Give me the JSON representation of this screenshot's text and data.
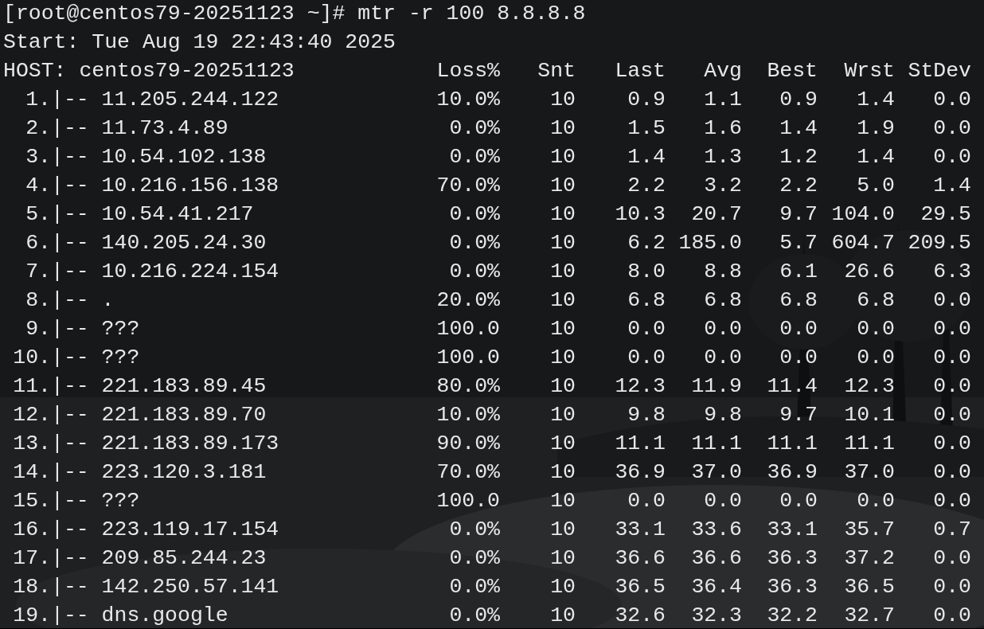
{
  "prompt": "[root@centos79-20251123 ~]# mtr -r 100 8.8.8.8",
  "start": "Start: Tue Aug 19 22:43:40 2025",
  "report": {
    "host_label": "HOST: centos79-20251123",
    "columns": [
      "Loss%",
      "Snt",
      "Last",
      "Avg",
      "Best",
      "Wrst",
      "StDev"
    ],
    "rows": [
      {
        "hop": "1.",
        "host": "|-- 11.205.244.122",
        "values": [
          "10.0%",
          "10",
          "0.9",
          "1.1",
          "0.9",
          "1.4",
          "0.0"
        ]
      },
      {
        "hop": "2.",
        "host": "|-- 11.73.4.89",
        "values": [
          "0.0%",
          "10",
          "1.5",
          "1.6",
          "1.4",
          "1.9",
          "0.0"
        ]
      },
      {
        "hop": "3.",
        "host": "|-- 10.54.102.138",
        "values": [
          "0.0%",
          "10",
          "1.4",
          "1.3",
          "1.2",
          "1.4",
          "0.0"
        ]
      },
      {
        "hop": "4.",
        "host": "|-- 10.216.156.138",
        "values": [
          "70.0%",
          "10",
          "2.2",
          "3.2",
          "2.2",
          "5.0",
          "1.4"
        ]
      },
      {
        "hop": "5.",
        "host": "|-- 10.54.41.217",
        "values": [
          "0.0%",
          "10",
          "10.3",
          "20.7",
          "9.7",
          "104.0",
          "29.5"
        ]
      },
      {
        "hop": "6.",
        "host": "|-- 140.205.24.30",
        "values": [
          "0.0%",
          "10",
          "6.2",
          "185.0",
          "5.7",
          "604.7",
          "209.5"
        ]
      },
      {
        "hop": "7.",
        "host": "|-- 10.216.224.154",
        "values": [
          "0.0%",
          "10",
          "8.0",
          "8.8",
          "6.1",
          "26.6",
          "6.3"
        ]
      },
      {
        "hop": "8.",
        "host": "|-- .",
        "values": [
          "20.0%",
          "10",
          "6.8",
          "6.8",
          "6.8",
          "6.8",
          "0.0"
        ]
      },
      {
        "hop": "9.",
        "host": "|-- ???",
        "values": [
          "100.0",
          "10",
          "0.0",
          "0.0",
          "0.0",
          "0.0",
          "0.0"
        ]
      },
      {
        "hop": "10.",
        "host": "|-- ???",
        "values": [
          "100.0",
          "10",
          "0.0",
          "0.0",
          "0.0",
          "0.0",
          "0.0"
        ]
      },
      {
        "hop": "11.",
        "host": "|-- 221.183.89.45",
        "values": [
          "80.0%",
          "10",
          "12.3",
          "11.9",
          "11.4",
          "12.3",
          "0.0"
        ]
      },
      {
        "hop": "12.",
        "host": "|-- 221.183.89.70",
        "values": [
          "10.0%",
          "10",
          "9.8",
          "9.8",
          "9.7",
          "10.1",
          "0.0"
        ]
      },
      {
        "hop": "13.",
        "host": "|-- 221.183.89.173",
        "values": [
          "90.0%",
          "10",
          "11.1",
          "11.1",
          "11.1",
          "11.1",
          "0.0"
        ]
      },
      {
        "hop": "14.",
        "host": "|-- 223.120.3.181",
        "values": [
          "70.0%",
          "10",
          "36.9",
          "37.0",
          "36.9",
          "37.0",
          "0.0"
        ]
      },
      {
        "hop": "15.",
        "host": "|-- ???",
        "values": [
          "100.0",
          "10",
          "0.0",
          "0.0",
          "0.0",
          "0.0",
          "0.0"
        ]
      },
      {
        "hop": "16.",
        "host": "|-- 223.119.17.154",
        "values": [
          "0.0%",
          "10",
          "33.1",
          "33.6",
          "33.1",
          "35.7",
          "0.7"
        ]
      },
      {
        "hop": "17.",
        "host": "|-- 209.85.244.23",
        "values": [
          "0.0%",
          "10",
          "36.6",
          "36.6",
          "36.3",
          "37.2",
          "0.0"
        ]
      },
      {
        "hop": "18.",
        "host": "|-- 142.250.57.141",
        "values": [
          "0.0%",
          "10",
          "36.5",
          "36.4",
          "36.3",
          "36.5",
          "0.0"
        ]
      },
      {
        "hop": "19.",
        "host": "|-- dns.google",
        "values": [
          "0.0%",
          "10",
          "32.6",
          "32.3",
          "32.2",
          "32.7",
          "0.0"
        ]
      }
    ]
  }
}
